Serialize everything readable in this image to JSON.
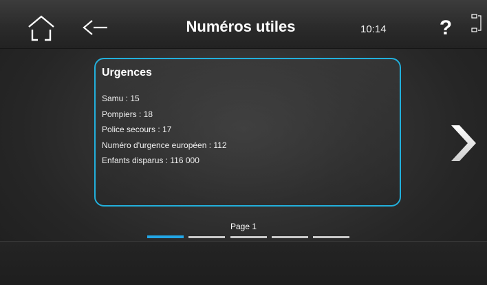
{
  "header": {
    "title": "Numéros utiles",
    "time": "10:14",
    "help_label": "?",
    "home_icon": "home-icon",
    "back_icon": "back-arrow-icon",
    "layout_icon": "layout-toggle-icon"
  },
  "card": {
    "title": "Urgences",
    "items": [
      "Samu : 15",
      "Pompiers : 18",
      "Police secours : 17",
      "Numéro d'urgence européen : 112",
      "Enfants disparus : 116 000"
    ]
  },
  "navigation": {
    "next_icon": "chevron-right-icon"
  },
  "pagination": {
    "label": "Page 1",
    "current_page": 1,
    "total_pages": 5
  },
  "colors": {
    "accent": "#22b0dc",
    "active_page": "#22a6e6",
    "inactive_page": "#c9c9c9"
  }
}
